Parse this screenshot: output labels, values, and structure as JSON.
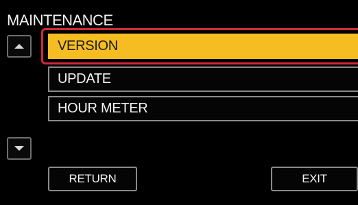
{
  "screen": {
    "title": "MAINTENANCE",
    "colors": {
      "background": "#000000",
      "selected_item": "#f5bd22",
      "highlight_frame": "#d4283a",
      "border": "#8a8a8a"
    }
  },
  "scroll": {
    "up_icon": "triangle-up-icon",
    "down_icon": "triangle-down-icon"
  },
  "menu": {
    "items": [
      {
        "label": "VERSION",
        "selected": true
      },
      {
        "label": "UPDATE",
        "selected": false
      },
      {
        "label": "HOUR METER",
        "selected": false
      }
    ]
  },
  "footer": {
    "return_label": "RETURN",
    "exit_label": "EXIT"
  }
}
